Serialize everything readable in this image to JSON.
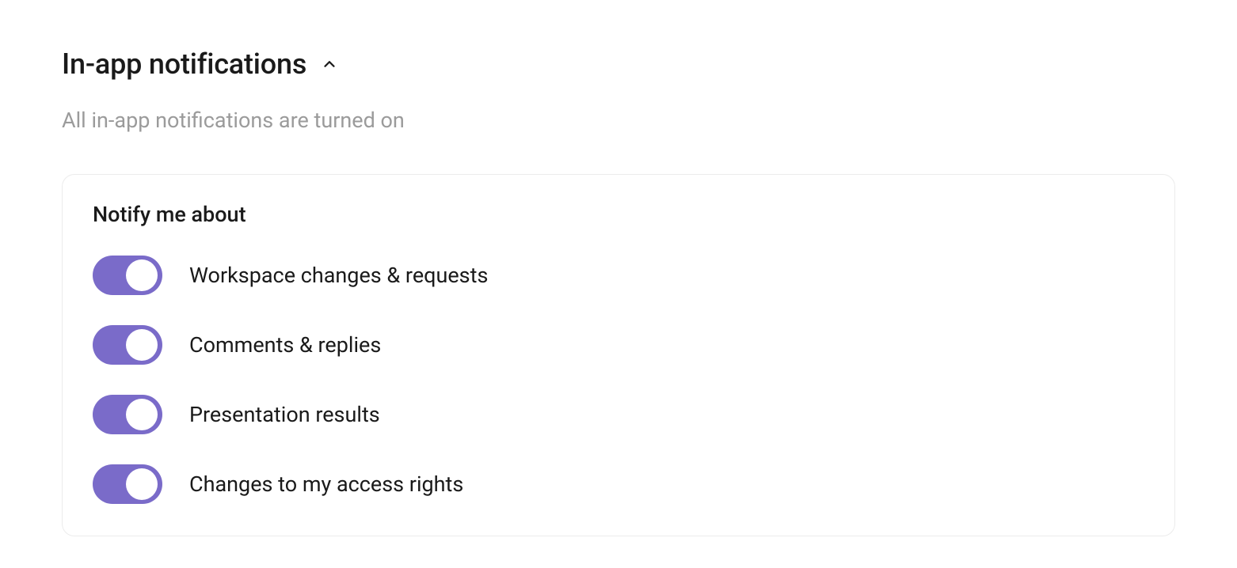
{
  "section": {
    "title": "In-app notifications",
    "subtitle": "All in-app notifications are turned on"
  },
  "panel": {
    "heading": "Notify me about",
    "items": [
      {
        "label": "Workspace changes & requests",
        "on": true
      },
      {
        "label": "Comments & replies",
        "on": true
      },
      {
        "label": "Presentation results",
        "on": true
      },
      {
        "label": "Changes to my access rights",
        "on": true
      }
    ]
  },
  "colors": {
    "toggle_on": "#7a6bc9",
    "border": "#ececec",
    "subtitle": "#9b9b9b"
  }
}
